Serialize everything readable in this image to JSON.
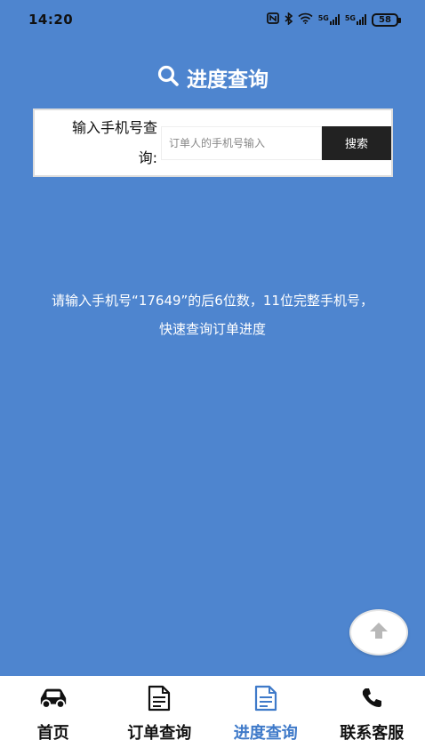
{
  "status_bar": {
    "time": "14:20",
    "nfc_icon": "nfc-icon",
    "bluetooth_icon": "bluetooth-icon",
    "wifi_icon": "wifi-icon",
    "signal_1_label": "5G",
    "signal_2_label": "5G",
    "battery": "58"
  },
  "header": {
    "icon": "search-icon",
    "title": "进度查询"
  },
  "search": {
    "label_line1": "输入手机号查",
    "label_line2": "询:",
    "placeholder": "订单人的手机号输入",
    "button_label": "搜索"
  },
  "hint": {
    "line1": "请输入手机号“17649”的后6位数，11位完整手机号，",
    "line2": "快速查询订单进度"
  },
  "scroll_top": {
    "icon": "arrow-up-icon"
  },
  "tabbar": {
    "items": [
      {
        "label": "首页",
        "icon": "car-icon",
        "active": false
      },
      {
        "label": "订单查询",
        "icon": "document-icon",
        "active": false
      },
      {
        "label": "进度查询",
        "icon": "document-icon",
        "active": true
      },
      {
        "label": "联系客服",
        "icon": "phone-icon",
        "active": false
      }
    ],
    "active_color": "#3f7ac9"
  },
  "colors": {
    "background": "#4e85cf",
    "button": "#222222"
  }
}
